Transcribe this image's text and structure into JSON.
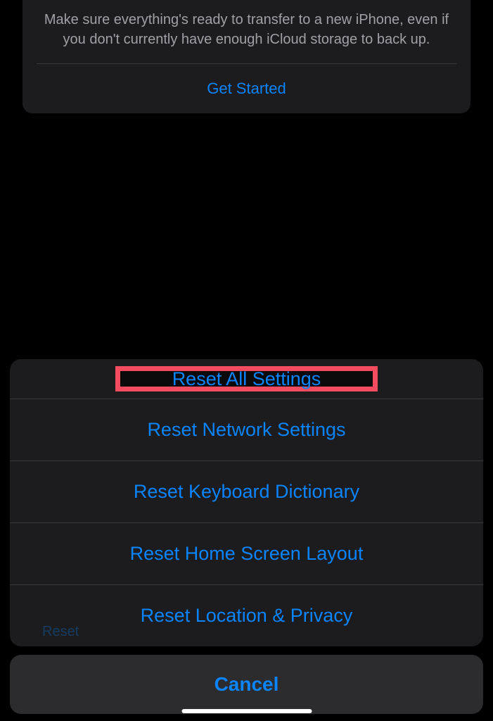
{
  "backup": {
    "description": "Make sure everything's ready to transfer to a new iPhone, even if you don't currently have enough iCloud storage to back up.",
    "get_started_label": "Get Started"
  },
  "action_sheet": {
    "options": [
      {
        "label": "Reset All Settings",
        "highlighted": true
      },
      {
        "label": "Reset Network Settings",
        "highlighted": false
      },
      {
        "label": "Reset Keyboard Dictionary",
        "highlighted": false
      },
      {
        "label": "Reset Home Screen Layout",
        "highlighted": false
      },
      {
        "label": "Reset Location & Privacy",
        "highlighted": false
      }
    ],
    "cancel_label": "Cancel"
  },
  "background_hint": "Reset"
}
